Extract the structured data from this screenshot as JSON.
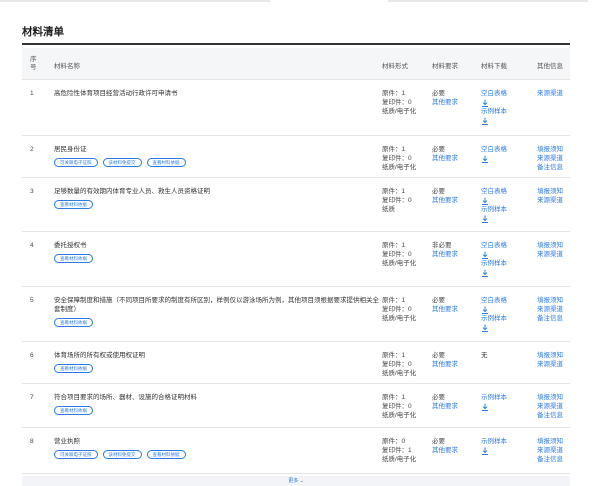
{
  "title": "材料清单",
  "headers": {
    "num": "序号",
    "name": "材料名称",
    "form": "材料形式",
    "req": "材料要求",
    "download": "材料下载",
    "other": "其他信息"
  },
  "rows": [
    {
      "num": "1",
      "name": "高危险性体育项目经营活动行政许可申请书",
      "tags": [],
      "form": [
        "原件：1",
        "复印件：0",
        "纸质/电子化"
      ],
      "req": "必要",
      "req_link": "其他要求",
      "downloads": [
        "空白表格",
        "icon",
        "示例样本",
        "icon"
      ],
      "other": [
        "来源渠道"
      ]
    },
    {
      "num": "2",
      "name": "居民身份证",
      "tags": [
        "可关联电子证照",
        "该材料免提交",
        "查看材料依据"
      ],
      "form": [
        "原件：1",
        "复印件：0",
        "纸质/电子化"
      ],
      "req": "必要",
      "req_link": "其他要求",
      "downloads": [
        "空白表格",
        "icon"
      ],
      "other": [
        "填报须知",
        "来源渠道",
        "备注信息"
      ]
    },
    {
      "num": "3",
      "name": "足够数量的有效期内体育专业人员、救生人员资格证明",
      "tags": [
        "查看材料依据"
      ],
      "form": [
        "原件：1",
        "复印件：0",
        "纸质"
      ],
      "req": "必要",
      "req_link": "其他要求",
      "downloads": [
        "空白表格",
        "icon",
        "示例样本",
        "icon"
      ],
      "other": [
        "填报须知",
        "来源渠道"
      ]
    },
    {
      "num": "4",
      "name": "委托授权书",
      "tags": [
        "查看材料依据"
      ],
      "form": [
        "原件：1",
        "复印件：0",
        "纸质/电子化"
      ],
      "req": "非必要",
      "req_link": "其他要求",
      "downloads": [
        "空白表格",
        "icon",
        "示例样本",
        "icon"
      ],
      "other": [
        "填报须知",
        "来源渠道"
      ]
    },
    {
      "num": "5",
      "name": "安全保障制度和措施（不同项目所要求的制度有所区别，样例仅以游泳场所为例，其他项目须根据要求提供相关全套制度）",
      "tags": [
        "查看材料依据"
      ],
      "form": [
        "原件：1",
        "复印件：0",
        "纸质/电子化"
      ],
      "req": "必要",
      "req_link": "其他要求",
      "downloads": [
        "空白表格",
        "icon",
        "示例样本",
        "icon"
      ],
      "other": [
        "填报须知",
        "来源渠道",
        "备注信息"
      ]
    },
    {
      "num": "6",
      "name": "体育场所的所有权或使用权证明",
      "tags": [
        "查看材料依据"
      ],
      "form": [
        "原件：1",
        "复印件：0",
        "纸质/电子化"
      ],
      "req": "必要",
      "req_link": "其他要求",
      "downloads_text": "无",
      "downloads": [],
      "other": [
        "填报须知",
        "来源渠道"
      ]
    },
    {
      "num": "7",
      "name": "符合项目要求的场所、器材、设施的合格证明材料",
      "tags": [
        "查看材料依据"
      ],
      "form": [
        "原件：1",
        "复印件：0",
        "纸质/电子化"
      ],
      "req": "必要",
      "req_link": "其他要求",
      "downloads": [
        "示例样本",
        "icon"
      ],
      "other": [
        "填报须知",
        "来源渠道",
        "备注信息"
      ]
    },
    {
      "num": "8",
      "name": "营业执照",
      "tags": [
        "可关联电子证照",
        "该材料免提交",
        "查看材料依据"
      ],
      "form": [
        "原件：0",
        "复印件：1",
        "纸质/电子化"
      ],
      "req": "必要",
      "req_link": "其他要求",
      "downloads": [
        "示例样本",
        "icon"
      ],
      "other": [
        "填报须知",
        "来源渠道",
        "备注信息"
      ]
    }
  ],
  "more_label": "更多",
  "colors": {
    "link": "#2a7ae2",
    "header_bg": "#f5f6f8",
    "divider": "#e4e4e4"
  }
}
